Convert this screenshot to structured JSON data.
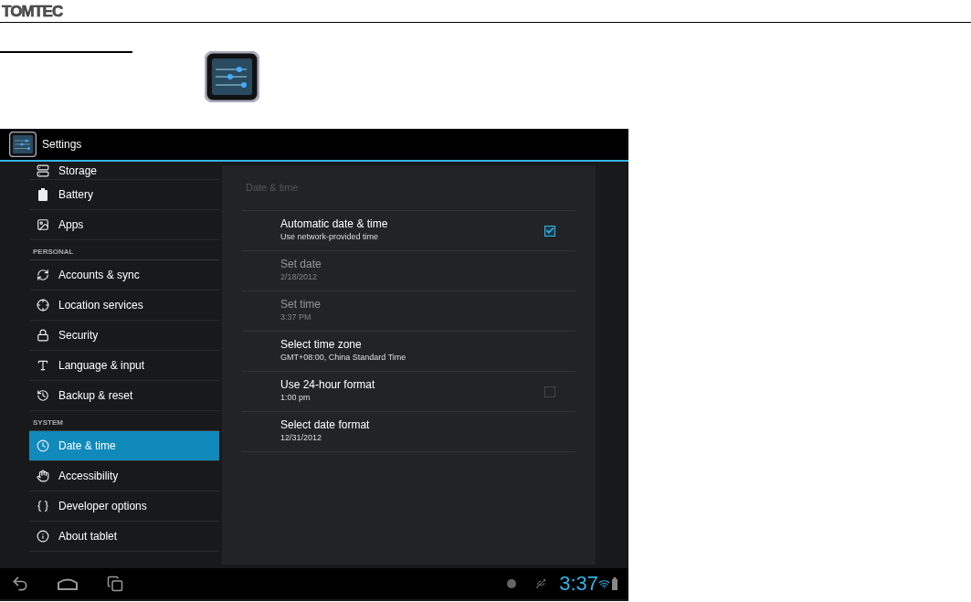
{
  "document": {
    "logo": "TOMTEC"
  },
  "screen": {
    "title": "Settings",
    "sidebar": [
      {
        "kind": "item",
        "label": "Storage",
        "selected": false
      },
      {
        "kind": "item",
        "label": "Battery",
        "selected": false
      },
      {
        "kind": "item",
        "label": "Apps",
        "selected": false
      },
      {
        "kind": "header",
        "label": "PERSONAL"
      },
      {
        "kind": "item",
        "label": "Accounts & sync",
        "selected": false
      },
      {
        "kind": "item",
        "label": "Location services",
        "selected": false
      },
      {
        "kind": "item",
        "label": "Security",
        "selected": false
      },
      {
        "kind": "item",
        "label": "Language & input",
        "selected": false
      },
      {
        "kind": "item",
        "label": "Backup & reset",
        "selected": false
      },
      {
        "kind": "header",
        "label": "SYSTEM"
      },
      {
        "kind": "item",
        "label": "Date & time",
        "selected": true
      },
      {
        "kind": "item",
        "label": "Accessibility",
        "selected": false
      },
      {
        "kind": "item",
        "label": "Developer options",
        "selected": false
      },
      {
        "kind": "item",
        "label": "About tablet",
        "selected": false
      }
    ],
    "detail": {
      "title": "Date & time",
      "rows": [
        {
          "kind": "checkbox",
          "title": "Automatic date & time",
          "summary": "Use network-provided time",
          "disabled": false,
          "checked": true
        },
        {
          "kind": "plain",
          "title": "Set date",
          "summary": "2/18/2012",
          "disabled": true
        },
        {
          "kind": "plain",
          "title": "Set time",
          "summary": "3:37 PM",
          "disabled": true
        },
        {
          "kind": "plain",
          "title": "Select time zone",
          "summary": "GMT+08:00, China Standard Time",
          "disabled": false
        },
        {
          "kind": "checkbox",
          "title": "Use 24-hour format",
          "summary": "1:00 pm",
          "disabled": false,
          "checked": false
        },
        {
          "kind": "plain",
          "title": "Select date format",
          "summary": "12/31/2012",
          "disabled": false
        }
      ]
    },
    "status_bar": {
      "time": "3:37"
    }
  }
}
